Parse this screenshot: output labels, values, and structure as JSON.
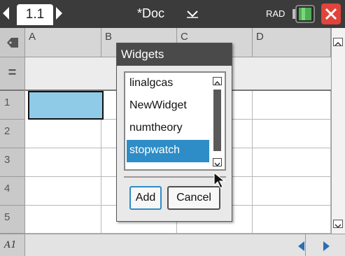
{
  "topbar": {
    "page_tab": "1.1",
    "doc_title": "*Doc",
    "angle_mode": "RAD",
    "icons": [
      "chevron-left-icon",
      "chevron-right-icon",
      "caret-down-icon",
      "battery-icon",
      "close-icon"
    ]
  },
  "spreadsheet": {
    "columns": [
      "A",
      "B",
      "C",
      "D"
    ],
    "rows": [
      "1",
      "2",
      "3",
      "4",
      "5"
    ],
    "formula_row_label": "=",
    "selected_cell": "A1",
    "selected_color": "#8fcbe6"
  },
  "dialog": {
    "title": "Widgets",
    "items": [
      "linalgcas",
      "NewWidget",
      "numtheory",
      "stopwatch"
    ],
    "selected_item": "stopwatch",
    "add_label": "Add",
    "cancel_label": "Cancel"
  },
  "statusbar": {
    "cell_ref": "A1"
  },
  "colors": {
    "topbar": "#3b3b3b",
    "selection": "#2e8cc6",
    "close": "#e0443a",
    "battery": "#4caf50"
  }
}
